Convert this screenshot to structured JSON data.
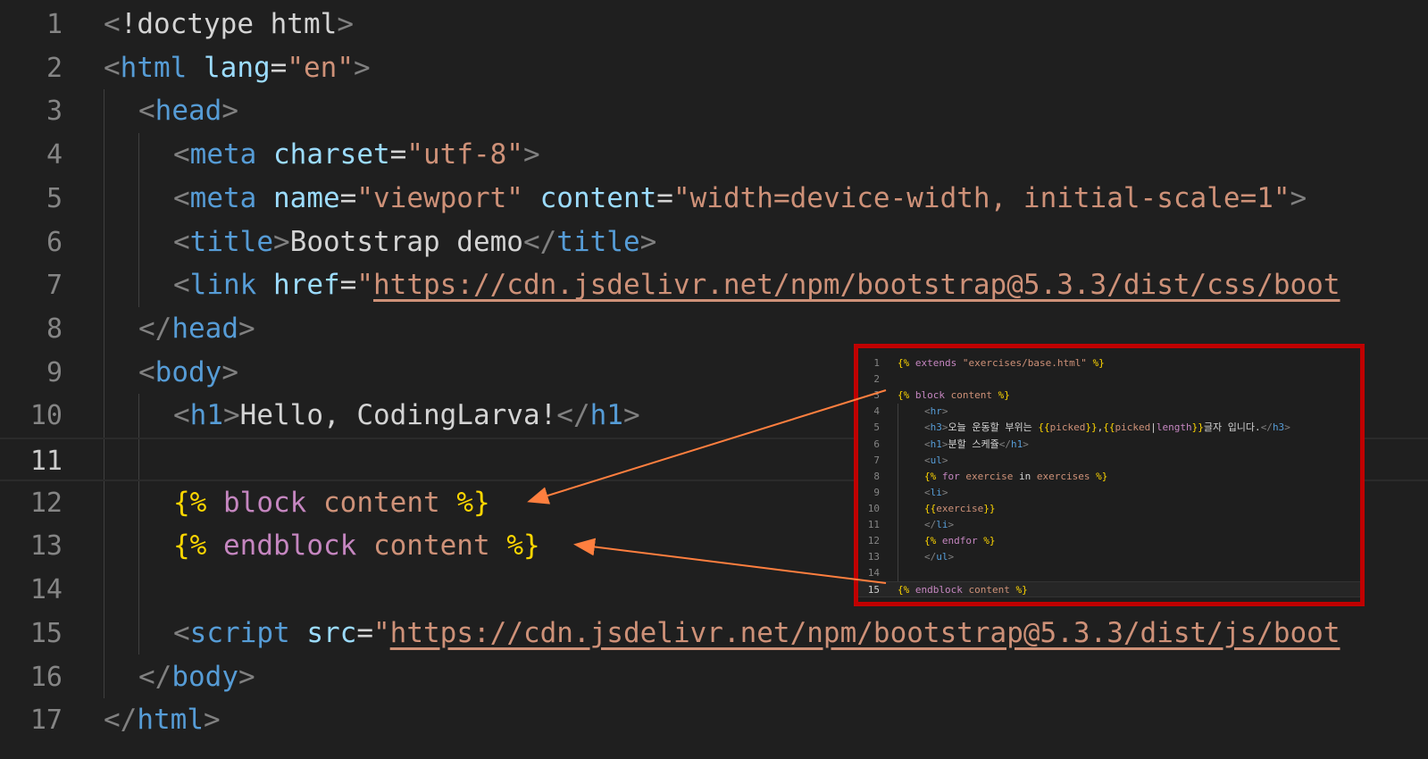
{
  "editor": {
    "current_line": 11,
    "lines": [
      {
        "n": "1",
        "tokens": [
          [
            "pn",
            "<"
          ],
          [
            "tx",
            "!doctype html"
          ],
          [
            "pn",
            ">"
          ]
        ]
      },
      {
        "n": "2",
        "tokens": [
          [
            "pn",
            "<"
          ],
          [
            "tg",
            "html"
          ],
          [
            "tx",
            " "
          ],
          [
            "at",
            "lang"
          ],
          [
            "tx",
            "="
          ],
          [
            "st",
            "\"en\""
          ],
          [
            "pn",
            ">"
          ]
        ]
      },
      {
        "n": "3",
        "tokens": [
          [
            "pn",
            "<"
          ],
          [
            "tg",
            "head"
          ],
          [
            "pn",
            ">"
          ]
        ]
      },
      {
        "n": "4",
        "tokens": [
          [
            "pn",
            "<"
          ],
          [
            "tg",
            "meta"
          ],
          [
            "tx",
            " "
          ],
          [
            "at",
            "charset"
          ],
          [
            "tx",
            "="
          ],
          [
            "st",
            "\"utf-8\""
          ],
          [
            "pn",
            ">"
          ]
        ]
      },
      {
        "n": "5",
        "tokens": [
          [
            "pn",
            "<"
          ],
          [
            "tg",
            "meta"
          ],
          [
            "tx",
            " "
          ],
          [
            "at",
            "name"
          ],
          [
            "tx",
            "="
          ],
          [
            "st",
            "\"viewport\""
          ],
          [
            "tx",
            " "
          ],
          [
            "at",
            "content"
          ],
          [
            "tx",
            "="
          ],
          [
            "st",
            "\"width=device-width, initial-scale=1\""
          ],
          [
            "pn",
            ">"
          ]
        ]
      },
      {
        "n": "6",
        "tokens": [
          [
            "pn",
            "<"
          ],
          [
            "tg",
            "title"
          ],
          [
            "pn",
            ">"
          ],
          [
            "tx",
            "Bootstrap demo"
          ],
          [
            "pn",
            "</"
          ],
          [
            "tg",
            "title"
          ],
          [
            "pn",
            ">"
          ]
        ]
      },
      {
        "n": "7",
        "tokens": [
          [
            "pn",
            "<"
          ],
          [
            "tg",
            "link"
          ],
          [
            "tx",
            " "
          ],
          [
            "at",
            "href"
          ],
          [
            "tx",
            "="
          ],
          [
            "st",
            "\""
          ],
          [
            "lk",
            "https://cdn.jsdelivr.net/npm/bootstrap@5.3.3/dist/css/boot"
          ]
        ]
      },
      {
        "n": "8",
        "tokens": [
          [
            "pn",
            "</"
          ],
          [
            "tg",
            "head"
          ],
          [
            "pn",
            ">"
          ]
        ]
      },
      {
        "n": "9",
        "tokens": [
          [
            "pn",
            "<"
          ],
          [
            "tg",
            "body"
          ],
          [
            "pn",
            ">"
          ]
        ]
      },
      {
        "n": "10",
        "tokens": [
          [
            "pn",
            "<"
          ],
          [
            "tg",
            "h1"
          ],
          [
            "pn",
            ">"
          ],
          [
            "tx",
            "Hello, CodingLarva!"
          ],
          [
            "pn",
            "</"
          ],
          [
            "tg",
            "h1"
          ],
          [
            "pn",
            ">"
          ]
        ]
      },
      {
        "n": "11",
        "tokens": []
      },
      {
        "n": "12",
        "tokens": [
          [
            "jb",
            "{%"
          ],
          [
            "tx",
            " "
          ],
          [
            "kw",
            "block"
          ],
          [
            "tx",
            " "
          ],
          [
            "id",
            "content"
          ],
          [
            "tx",
            " "
          ],
          [
            "jb",
            "%}"
          ]
        ]
      },
      {
        "n": "13",
        "tokens": [
          [
            "jb",
            "{%"
          ],
          [
            "tx",
            " "
          ],
          [
            "kw",
            "endblock"
          ],
          [
            "tx",
            " "
          ],
          [
            "id",
            "content"
          ],
          [
            "tx",
            " "
          ],
          [
            "jb",
            "%}"
          ]
        ]
      },
      {
        "n": "14",
        "tokens": []
      },
      {
        "n": "15",
        "tokens": [
          [
            "pn",
            "<"
          ],
          [
            "tg",
            "script"
          ],
          [
            "tx",
            " "
          ],
          [
            "at",
            "src"
          ],
          [
            "tx",
            "="
          ],
          [
            "st",
            "\""
          ],
          [
            "lk",
            "https://cdn.jsdelivr.net/npm/bootstrap@5.3.3/dist/js/boot"
          ]
        ]
      },
      {
        "n": "16",
        "tokens": [
          [
            "pn",
            "</"
          ],
          [
            "tg",
            "body"
          ],
          [
            "pn",
            ">"
          ]
        ]
      },
      {
        "n": "17",
        "tokens": [
          [
            "pn",
            "</"
          ],
          [
            "tg",
            "html"
          ],
          [
            "pn",
            ">"
          ]
        ]
      }
    ]
  },
  "inset": {
    "current_line": 15,
    "lines": [
      {
        "n": "1",
        "tokens": [
          [
            "jb",
            "{%"
          ],
          [
            "tx",
            " "
          ],
          [
            "kw",
            "extends"
          ],
          [
            "tx",
            " "
          ],
          [
            "st",
            "\"exercises/base.html\""
          ],
          [
            "tx",
            " "
          ],
          [
            "jb",
            "%}"
          ]
        ]
      },
      {
        "n": "2",
        "tokens": []
      },
      {
        "n": "3",
        "tokens": [
          [
            "jb",
            "{%"
          ],
          [
            "tx",
            " "
          ],
          [
            "kw",
            "block"
          ],
          [
            "tx",
            " "
          ],
          [
            "id",
            "content"
          ],
          [
            "tx",
            " "
          ],
          [
            "jb",
            "%}"
          ]
        ]
      },
      {
        "n": "4",
        "tokens": [
          [
            "pn",
            "<"
          ],
          [
            "tg",
            "hr"
          ],
          [
            "pn",
            ">"
          ]
        ]
      },
      {
        "n": "5",
        "tokens": [
          [
            "pn",
            "<"
          ],
          [
            "tg",
            "h3"
          ],
          [
            "pn",
            ">"
          ],
          [
            "tx",
            "오늘 운동할 부위는 "
          ],
          [
            "jb",
            "{{"
          ],
          [
            "id",
            "picked"
          ],
          [
            "jb",
            "}}"
          ],
          [
            "tx",
            ","
          ],
          [
            "jb",
            "{{"
          ],
          [
            "id",
            "picked"
          ],
          [
            "tx",
            "|"
          ],
          [
            "kw",
            "length"
          ],
          [
            "jb",
            "}}"
          ],
          [
            "tx",
            "글자 입니다."
          ],
          [
            "pn",
            "</"
          ],
          [
            "tg",
            "h3"
          ],
          [
            "pn",
            ">"
          ]
        ]
      },
      {
        "n": "6",
        "tokens": [
          [
            "pn",
            "<"
          ],
          [
            "tg",
            "h1"
          ],
          [
            "pn",
            ">"
          ],
          [
            "tx",
            "분할 스케쥴"
          ],
          [
            "pn",
            "</"
          ],
          [
            "tg",
            "h1"
          ],
          [
            "pn",
            ">"
          ]
        ]
      },
      {
        "n": "7",
        "tokens": [
          [
            "pn",
            "<"
          ],
          [
            "tg",
            "ul"
          ],
          [
            "pn",
            ">"
          ]
        ]
      },
      {
        "n": "8",
        "tokens": [
          [
            "jb",
            "{%"
          ],
          [
            "tx",
            " "
          ],
          [
            "kw",
            "for"
          ],
          [
            "tx",
            " "
          ],
          [
            "id",
            "exercise"
          ],
          [
            "tx",
            " in "
          ],
          [
            "id",
            "exercises"
          ],
          [
            "tx",
            " "
          ],
          [
            "jb",
            "%}"
          ]
        ]
      },
      {
        "n": "9",
        "tokens": [
          [
            "pn",
            "<"
          ],
          [
            "tg",
            "li"
          ],
          [
            "pn",
            ">"
          ]
        ]
      },
      {
        "n": "10",
        "tokens": [
          [
            "jb",
            "{{"
          ],
          [
            "id",
            "exercise"
          ],
          [
            "jb",
            "}}"
          ]
        ]
      },
      {
        "n": "11",
        "tokens": [
          [
            "pn",
            "</"
          ],
          [
            "tg",
            "li"
          ],
          [
            "pn",
            ">"
          ]
        ]
      },
      {
        "n": "12",
        "tokens": [
          [
            "jb",
            "{%"
          ],
          [
            "tx",
            " "
          ],
          [
            "kw",
            "endfor"
          ],
          [
            "tx",
            " "
          ],
          [
            "jb",
            "%}"
          ]
        ]
      },
      {
        "n": "13",
        "tokens": [
          [
            "pn",
            "</"
          ],
          [
            "tg",
            "ul"
          ],
          [
            "pn",
            ">"
          ]
        ]
      },
      {
        "n": "14",
        "tokens": []
      },
      {
        "n": "15",
        "tokens": [
          [
            "jb",
            "{%"
          ],
          [
            "tx",
            " "
          ],
          [
            "kw",
            "endblock"
          ],
          [
            "tx",
            " "
          ],
          [
            "id",
            "content"
          ],
          [
            "tx",
            " "
          ],
          [
            "jb",
            "%}"
          ]
        ]
      }
    ]
  },
  "colors": {
    "inset_border": "#c00000",
    "arrow": "#ff7f3f"
  }
}
